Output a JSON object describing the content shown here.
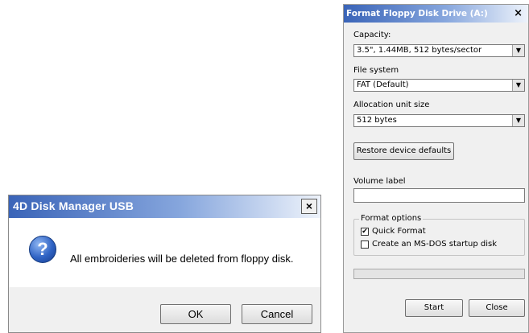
{
  "disk_manager_dialog": {
    "title": "4D Disk Manager USB",
    "close_glyph": "×",
    "icon": "question-icon",
    "icon_glyph": "?",
    "message": "All embroideries will be deleted from floppy disk.",
    "ok_label": "OK",
    "cancel_label": "Cancel"
  },
  "format_dialog": {
    "title": "Format Floppy Disk Drive (A:)",
    "close_glyph": "×",
    "capacity": {
      "label": "Capacity:",
      "value": "3.5\",  1.44MB, 512 bytes/sector"
    },
    "file_system": {
      "label": "File system",
      "value": "FAT (Default)"
    },
    "allocation": {
      "label": "Allocation unit size",
      "value": "512 bytes"
    },
    "restore_label": "Restore device defaults",
    "volume_label": {
      "label": "Volume label",
      "value": ""
    },
    "format_options": {
      "legend": "Format options",
      "quick_format": {
        "label": "Quick Format",
        "checked": true,
        "mark": "✔"
      },
      "msdos_startup": {
        "label": "Create an MS-DOS startup disk",
        "checked": false,
        "mark": ""
      }
    },
    "progress": 0,
    "start_label": "Start",
    "close_label": "Close"
  }
}
